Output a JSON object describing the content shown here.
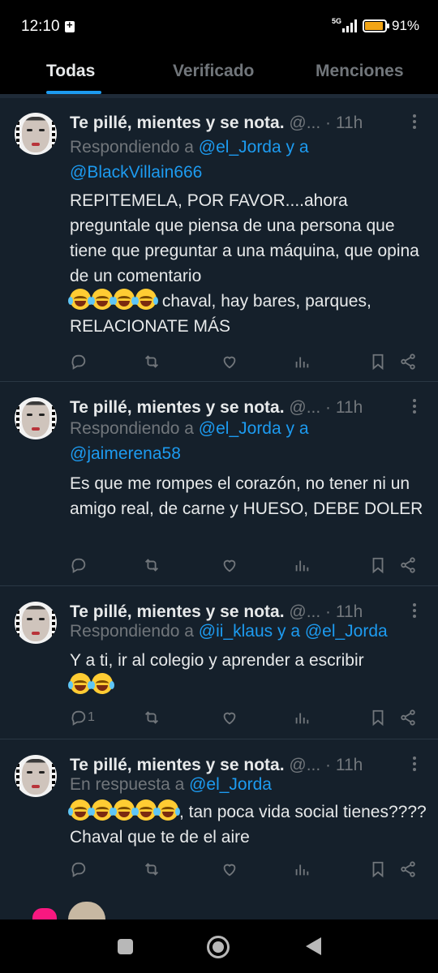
{
  "status_bar": {
    "time": "12:10",
    "network": "5G",
    "battery": "91%",
    "battery_level": 0.91
  },
  "tabs": [
    {
      "label": "Todas",
      "active": true
    },
    {
      "label": "Verificado",
      "active": false
    },
    {
      "label": "Menciones",
      "active": false
    }
  ],
  "tweets": [
    {
      "name": "Te pillé, mientes y se nota.",
      "handle": "@...",
      "time": "· 11h",
      "reply_prefix": "Respondiendo a ",
      "reply_link1": "@el_Jorda",
      "reply_join": " y a ",
      "reply_link2": "@BlackVillain666",
      "text": "REPITEMELA, POR FAVOR....ahora preguntale que piensa de una persona que tiene que preguntar a una máquina,  que opina de un comentario",
      "text_after": " chaval, hay bares, parques, RELACIONATE MÁS",
      "emoji_count": 4,
      "reply_count": ""
    },
    {
      "name": "Te pillé, mientes y se nota.",
      "handle": "@...",
      "time": "· 11h",
      "reply_prefix": "Respondiendo a ",
      "reply_link1": "@el_Jorda",
      "reply_join": " y a ",
      "reply_link2": "@jaimerena58",
      "text": "Es que me rompes el corazón,  no tener ni un amigo real, de carne y HUESO, DEBE DOLER",
      "reply_count": ""
    },
    {
      "name": "Te pillé, mientes y se nota.",
      "handle": "@...",
      "time": "· 11h",
      "reply_prefix": "Respondiendo a ",
      "reply_link1": "@ii_klaus y a @el_Jorda",
      "text": "Y a ti, ir al colegio y aprender a escribir",
      "emoji_count": 2,
      "reply_count": "1"
    },
    {
      "name": "Te pillé, mientes y se nota.",
      "handle": "@...",
      "time": "· 11h",
      "reply_prefix": "En respuesta a ",
      "reply_link1": "@el_Jorda",
      "text_after": ", tan poca vida social tienes???? Chaval que te de el aire",
      "emoji_count": 5,
      "reply_count": ""
    }
  ],
  "icons": {
    "reply": "reply-icon",
    "retweet": "retweet-icon",
    "like": "like-icon",
    "views": "views-icon",
    "bookmark": "bookmark-icon",
    "share": "share-icon"
  },
  "colors": {
    "background": "#15202b",
    "accent": "#1d9bf0",
    "muted": "#71767b"
  }
}
